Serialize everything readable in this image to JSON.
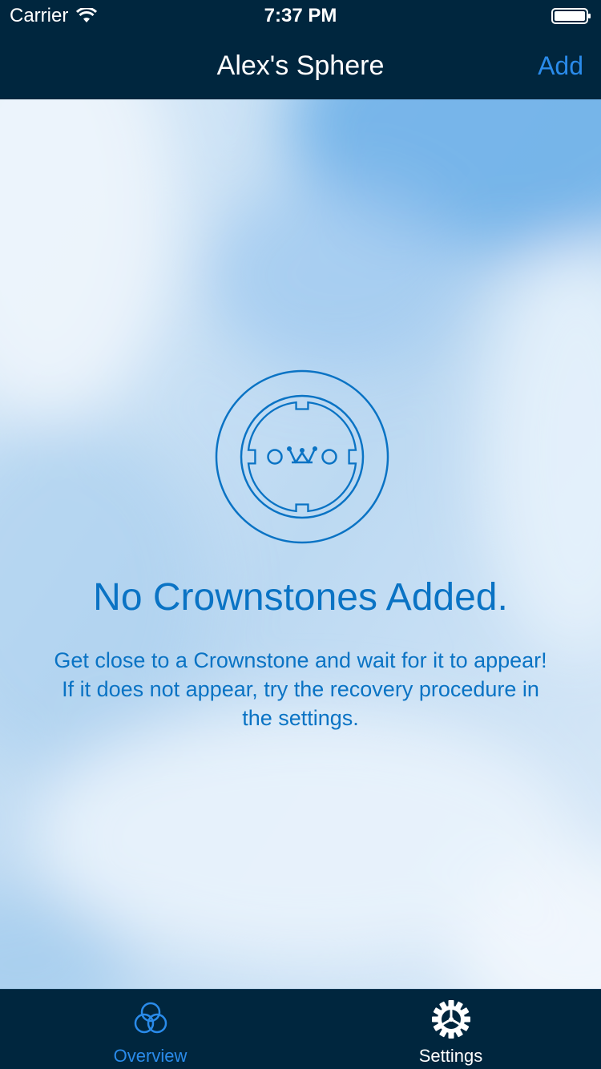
{
  "status_bar": {
    "carrier": "Carrier",
    "time": "7:37 PM"
  },
  "nav": {
    "title": "Alex's Sphere",
    "add_label": "Add"
  },
  "empty_state": {
    "title": "No Crownstones Added.",
    "message": "Get close to a Crownstone and wait for it to appear! If it does not appear, try the recovery procedure in the settings."
  },
  "tabs": [
    {
      "label": "Overview",
      "icon": "overview-circles-icon",
      "active": true
    },
    {
      "label": "Settings",
      "icon": "gear-icon",
      "active": false
    }
  ],
  "colors": {
    "nav_background": "#00263e",
    "accent": "#2a8bea",
    "content_text": "#0a73c4"
  }
}
